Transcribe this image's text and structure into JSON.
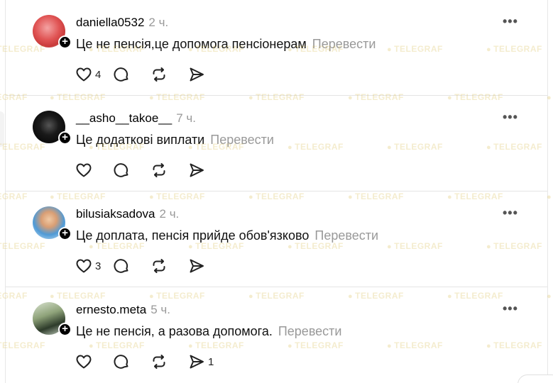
{
  "watermark": "TELEGRAF",
  "comments": [
    {
      "username": "daniella0532",
      "time": "2 ч.",
      "text": "Це не пенсія,це допомога пенсіонерам",
      "translate": "Перевести",
      "likes": "4",
      "shares": ""
    },
    {
      "username": "__asho__takoe__",
      "time": "7 ч.",
      "text": "Це додаткові виплати",
      "translate": "Перевести",
      "likes": "",
      "shares": ""
    },
    {
      "username": "bilusiaksadova",
      "time": "2 ч.",
      "text": "Це доплата, пенсія прийде обов'язково",
      "translate": "Перевести",
      "likes": "3",
      "shares": ""
    },
    {
      "username": "ernesto.meta",
      "time": "5 ч.",
      "text": "Це не пенсія, а разова допомога.",
      "translate": "Перевести",
      "likes": "",
      "shares": "1"
    }
  ],
  "icons": {
    "more": "more-horizontal-icon",
    "like": "heart-icon",
    "reply": "comment-bubble-icon",
    "repost": "repost-icon",
    "share": "send-icon",
    "follow": "plus-icon"
  },
  "colors": {
    "text": "#111111",
    "muted": "#999999",
    "divider": "#e4e4e4",
    "watermark": "#d7b950"
  }
}
